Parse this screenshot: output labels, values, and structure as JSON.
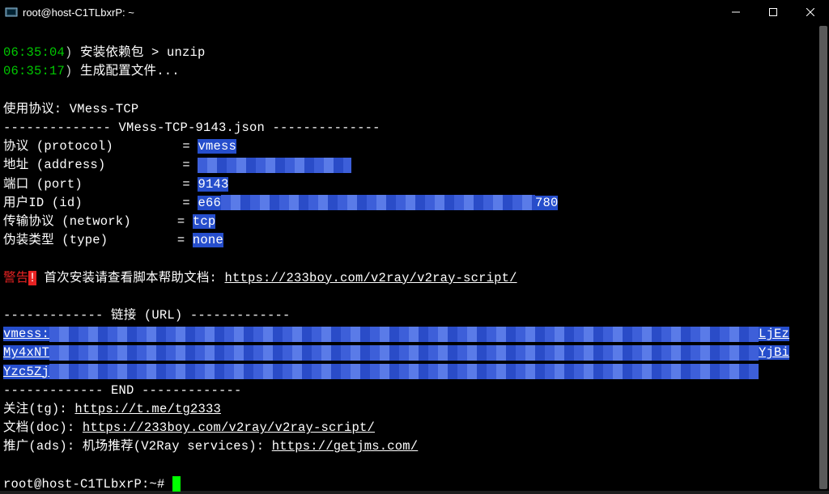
{
  "window": {
    "title": "root@host-C1TLbxrP: ~"
  },
  "lines": {
    "l1_ts": "06:35:04",
    "l1_paren": ")",
    "l1_txt": " 安装依赖包 > unzip",
    "l2_ts": "06:35:17",
    "l2_paren": ")",
    "l2_txt": " 生成配置文件...",
    "blank": " ",
    "proto_label": "使用协议: VMess-TCP",
    "header_dash": "-------------- VMess-TCP-9143.json --------------",
    "p_protocol_k": "协议 (protocol)         = ",
    "p_protocol_v": "vmess",
    "p_address_k": "地址 (address)          = ",
    "p_port_k": "端口 (port)             = ",
    "p_port_v": "9143",
    "p_id_k": "用户ID (id)             = ",
    "p_id_pre": "e66",
    "p_id_suf": "780",
    "p_network_k": "传输协议 (network)      = ",
    "p_network_v": "tcp",
    "p_type_k": "伪装类型 (type)         = ",
    "p_type_v": "none",
    "warn_a": "警告",
    "warn_b": "!",
    "warn_txt": " 首次安装请查看脚本帮助文档: ",
    "warn_url": "https://233boy.com/v2ray/v2ray-script/",
    "url_header": "------------- 链接 (URL) -------------",
    "vmess1a": "vmess:",
    "vmess1b": "LjEz",
    "vmess2a": "My4xNT",
    "vmess2b": "YjBi",
    "vmess3a": "Yzc5Zj",
    "end_dash": "------------- END -------------",
    "tg_k": "关注(tg): ",
    "tg_url": "https://t.me/tg2333",
    "doc_k": "文档(doc): ",
    "doc_url": "https://233boy.com/v2ray/v2ray-script/",
    "ads_k": "推广(ads): 机场推荐(V2Ray services): ",
    "ads_url": "https://getjms.com/",
    "prompt": "root@host-C1TLbxrP:~# "
  }
}
